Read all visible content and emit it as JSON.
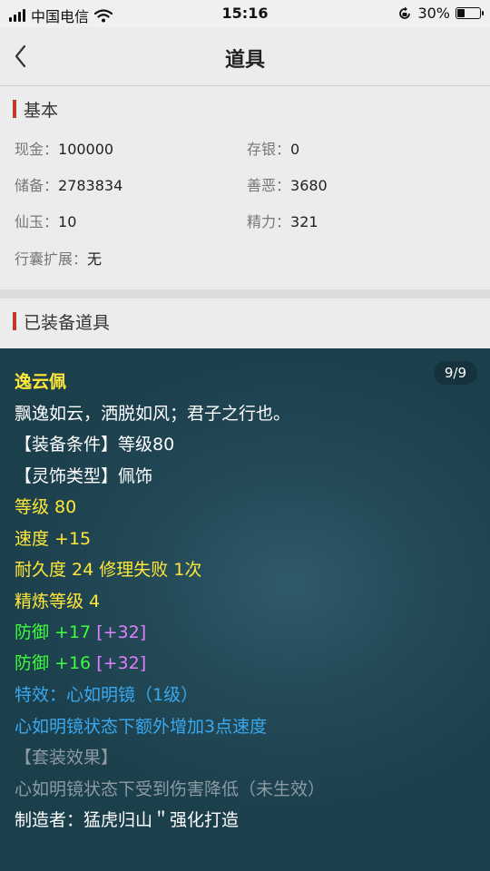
{
  "status_bar": {
    "carrier": "中国电信",
    "time": "15:16",
    "battery_percent": "30%",
    "battery_level": 0.3
  },
  "nav": {
    "title": "道具",
    "back_icon": "chevron-left-icon"
  },
  "basic": {
    "section_title": "基本",
    "fields": [
      {
        "label": "现金：",
        "value": "100000"
      },
      {
        "label": "存银：",
        "value": "0"
      },
      {
        "label": "储备：",
        "value": "2783834"
      },
      {
        "label": "善恶：",
        "value": "3680"
      },
      {
        "label": "仙玉：",
        "value": "10"
      },
      {
        "label": "精力：",
        "value": "321"
      },
      {
        "label": "行囊扩展：",
        "value": "无"
      }
    ]
  },
  "equipped": {
    "section_title": "已装备道具"
  },
  "item_detail": {
    "counter": "9/9",
    "name": "逸云佩",
    "description": "飘逸如云，洒脱如风；君子之行也。",
    "requirement": "【装备条件】等级80",
    "type": "【灵饰类型】佩饰",
    "level": "等级 80",
    "speed": "速度 +15",
    "durability": "耐久度 24 修理失败 1次",
    "refine": "精炼等级 4",
    "defense1": {
      "main": "防御 +17",
      "bonus": "[+32]"
    },
    "defense2": {
      "main": "防御 +16",
      "bonus": "[+32]"
    },
    "special": "特效：心如明镜（1级）",
    "special_desc": "心如明镜状态下额外增加3点速度",
    "set_title": "【套装效果】",
    "set_desc": "心如明镜状态下受到伤害降低（未生效）",
    "maker": "制造者：猛虎归山＂强化打造"
  },
  "colors": {
    "title_yellow": "#ffe83a",
    "green": "#3aff3a",
    "pink": "#e080ff",
    "blue": "#3aa8ee",
    "gray": "#8b9aa3",
    "accent_red": "#c0392b",
    "panel_bg": "#1c3f4c"
  }
}
